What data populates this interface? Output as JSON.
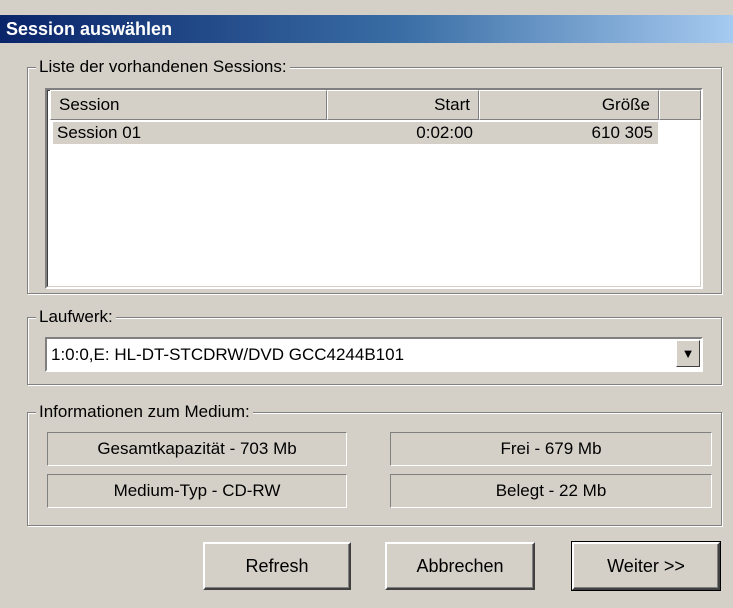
{
  "window": {
    "title": "Session auswählen"
  },
  "sessions": {
    "legend": "Liste der vorhandenen Sessions:",
    "columns": {
      "session": "Session",
      "start": "Start",
      "size": "Größe"
    },
    "rows": [
      {
        "session": "Session 01",
        "start": "0:02:00",
        "size": "610 305"
      }
    ]
  },
  "drive": {
    "legend": "Laufwerk:",
    "selected": "1:0:0,E: HL-DT-STCDRW/DVD GCC4244B101"
  },
  "media_info": {
    "legend": "Informationen zum Medium:",
    "total_capacity": "Gesamtkapazität - 703 Mb",
    "free": "Frei - 679 Mb",
    "media_type": "Medium-Typ - CD-RW",
    "used": "Belegt - 22 Mb"
  },
  "buttons": {
    "refresh": "Refresh",
    "cancel": "Abbrechen",
    "next": "Weiter >>"
  }
}
